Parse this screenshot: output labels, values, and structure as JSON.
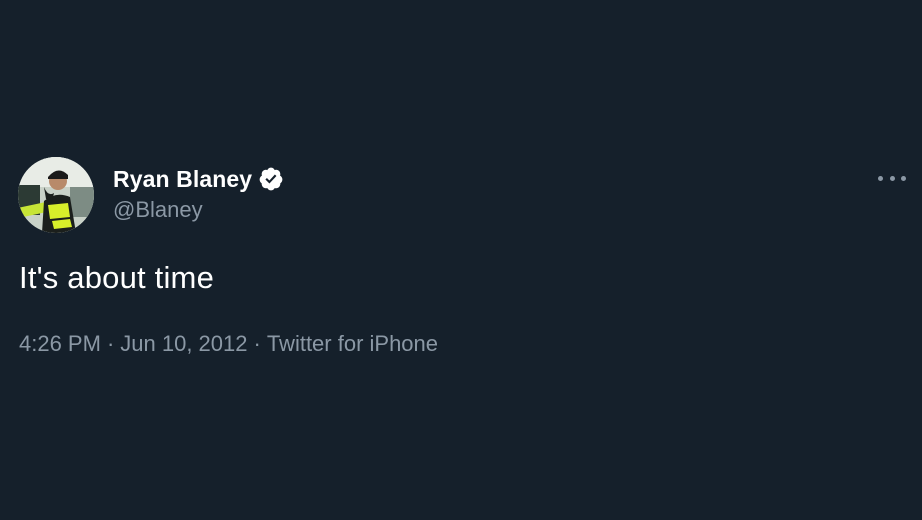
{
  "tweet": {
    "author": {
      "display_name": "Ryan Blaney",
      "handle": "@Blaney",
      "verified": true,
      "avatar_icon": "profile-photo"
    },
    "text": "It's about time",
    "time": "4:26 PM",
    "date": "Jun 10, 2012",
    "separator": "·",
    "source": "Twitter for iPhone",
    "more_icon": "more-horizontal-icon"
  },
  "colors": {
    "background": "#15202b",
    "primary_text": "#ffffff",
    "secondary_text": "#8b98a5",
    "verified_badge": "#ffffff"
  }
}
